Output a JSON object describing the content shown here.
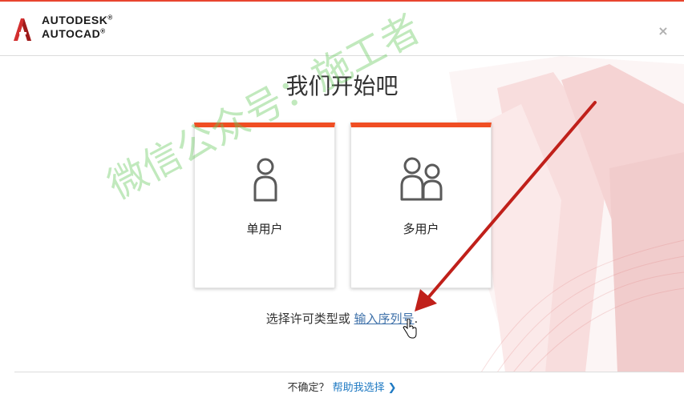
{
  "brand": {
    "line1": "AUTODESK",
    "line2": "AUTOCAD",
    "mark": "®"
  },
  "window": {
    "close_symbol": "×"
  },
  "title": "我们开始吧",
  "cards": [
    {
      "label": "单用户",
      "icon": "single-user-icon"
    },
    {
      "label": "多用户",
      "icon": "multi-user-icon"
    }
  ],
  "prompt": {
    "text": "选择许可类型或 ",
    "link": "输入序列号",
    "suffix": "."
  },
  "footer": {
    "question": "不确定？",
    "link": "帮助我选择",
    "chevron": "❯"
  },
  "watermark": "微信公众号：施工者",
  "colors": {
    "accent": "#f04e23",
    "link": "#3c6fa8",
    "footer_link": "#1f7ac3",
    "arrow": "#c0201a"
  }
}
